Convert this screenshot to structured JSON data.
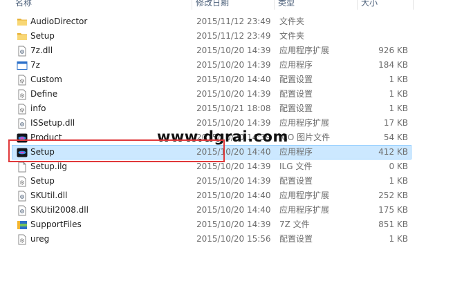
{
  "columns": {
    "name": "名称",
    "date": "修改日期",
    "type": "类型",
    "size": "大小"
  },
  "files": [
    {
      "name": "AudioDirector",
      "date": "2015/11/12 23:49",
      "type": "文件夹",
      "size": "",
      "icon": "folder-icon"
    },
    {
      "name": "Setup",
      "date": "2015/11/12 23:49",
      "type": "文件夹",
      "size": "",
      "icon": "folder-icon"
    },
    {
      "name": "7z.dll",
      "date": "2015/10/20 14:39",
      "type": "应用程序扩展",
      "size": "926 KB",
      "icon": "dll-file-icon"
    },
    {
      "name": "7z",
      "date": "2015/10/20 14:39",
      "type": "应用程序",
      "size": "184 KB",
      "icon": "exe-window-icon"
    },
    {
      "name": "Custom",
      "date": "2015/10/20 14:40",
      "type": "配置设置",
      "size": "1 KB",
      "icon": "settings-file-icon"
    },
    {
      "name": "Define",
      "date": "2015/10/20 14:39",
      "type": "配置设置",
      "size": "1 KB",
      "icon": "settings-file-icon"
    },
    {
      "name": "info",
      "date": "2015/10/21 18:08",
      "type": "配置设置",
      "size": "1 KB",
      "icon": "settings-file-icon"
    },
    {
      "name": "ISSetup.dll",
      "date": "2015/10/20 14:39",
      "type": "应用程序扩展",
      "size": "17 KB",
      "icon": "dll-file-icon"
    },
    {
      "name": "Product",
      "date": "2015/10/20 14:39",
      "type": "ICO 图片文件",
      "size": "54 KB",
      "icon": "app-logo-icon"
    },
    {
      "name": "Setup",
      "date": "2015/10/20 14:40",
      "type": "应用程序",
      "size": "412 KB",
      "icon": "app-logo-icon",
      "selected": true
    },
    {
      "name": "Setup.ilg",
      "date": "2015/10/20 14:39",
      "type": "ILG 文件",
      "size": "0 KB",
      "icon": "blank-file-icon"
    },
    {
      "name": "Setup",
      "date": "2015/10/20 14:39",
      "type": "配置设置",
      "size": "1 KB",
      "icon": "settings-file-icon"
    },
    {
      "name": "SKUtil.dll",
      "date": "2015/10/20 14:40",
      "type": "应用程序扩展",
      "size": "252 KB",
      "icon": "dll-file-icon"
    },
    {
      "name": "SKUtil2008.dll",
      "date": "2015/10/20 14:40",
      "type": "应用程序扩展",
      "size": "175 KB",
      "icon": "dll-file-icon"
    },
    {
      "name": "SupportFiles",
      "date": "2015/10/20 14:39",
      "type": "7Z 文件",
      "size": "851 KB",
      "icon": "archive-icon"
    },
    {
      "name": "ureg",
      "date": "2015/10/20 15:56",
      "type": "配置设置",
      "size": "1 KB",
      "icon": "settings-file-icon"
    }
  ],
  "watermark": "www.dgrai.com",
  "colors": {
    "selection_bg": "#cce8ff",
    "selection_border": "#99d1ff",
    "highlight_box": "#e0383a",
    "folder": "#f4c356"
  }
}
